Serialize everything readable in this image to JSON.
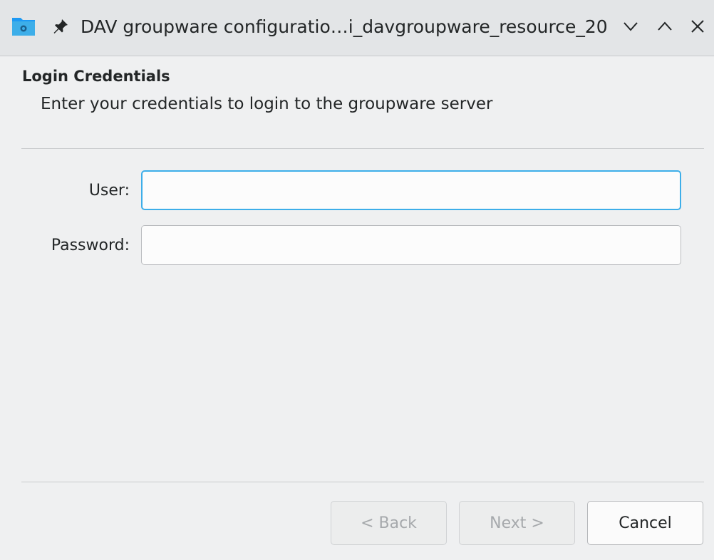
{
  "window": {
    "title": "DAV groupware configuratio…i_davgroupware_resource_20",
    "icons": {
      "app": "folder-network-icon",
      "pin": "pin-icon",
      "minimize": "chevron-down-icon",
      "maximize": "chevron-up-icon",
      "close": "close-icon"
    }
  },
  "page": {
    "heading": "Login Credentials",
    "subheading": "Enter your credentials to login to the groupware server"
  },
  "form": {
    "user_label": "User:",
    "user_value": "",
    "password_label": "Password:",
    "password_value": ""
  },
  "buttons": {
    "back": "< Back",
    "next": "Next >",
    "cancel": "Cancel"
  },
  "colors": {
    "focus": "#3daee9",
    "window_bg": "#eff0f1",
    "titlebar_bg": "#e3e5e7"
  }
}
